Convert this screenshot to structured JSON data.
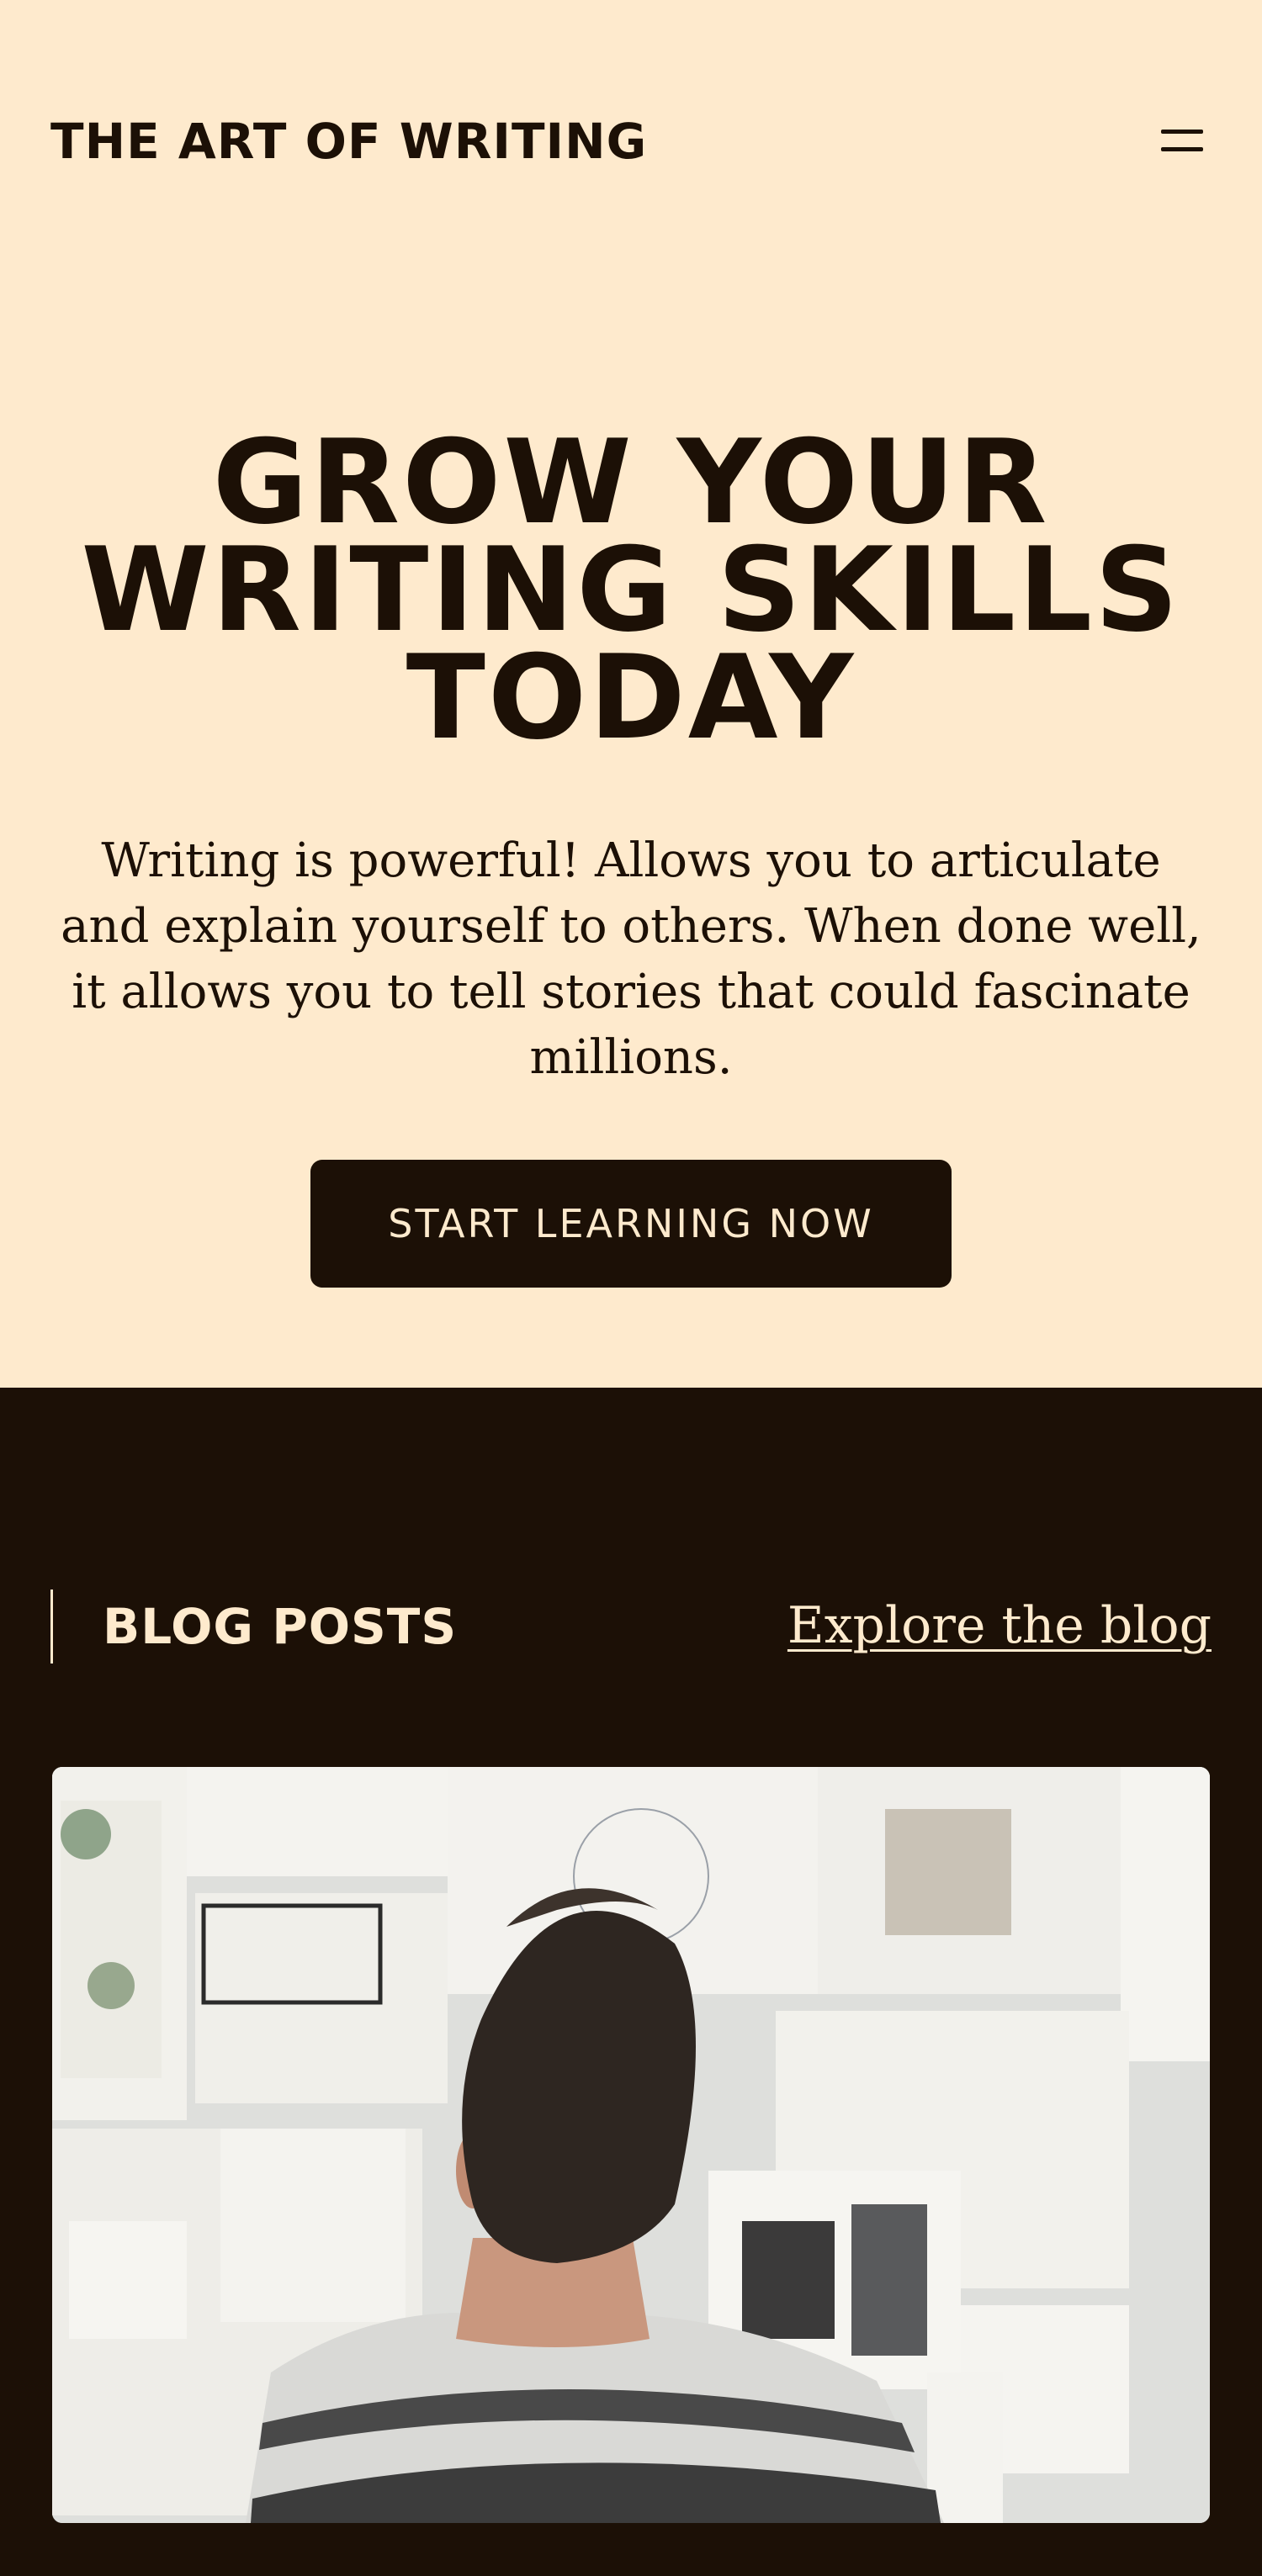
{
  "header": {
    "site_title": "THE ART OF WRITING",
    "menu_icon": "hamburger-menu-icon"
  },
  "hero": {
    "headline_lines": [
      "GROW YOUR",
      "WRITING SKILLS",
      "TODAY"
    ],
    "intro": "Writing is powerful! Allows you to articulate and explain yourself to others. When done well, it allows you to tell stories that could fascinate millions.",
    "cta_label": "START LEARNING NOW"
  },
  "blog": {
    "heading": "BLOG POSTS",
    "explore_link": "Explore the blog",
    "featured_image": "person-looking-at-pinboard-photo"
  },
  "colors": {
    "cream": "#feeacd",
    "dark_brown": "#1c1006"
  }
}
